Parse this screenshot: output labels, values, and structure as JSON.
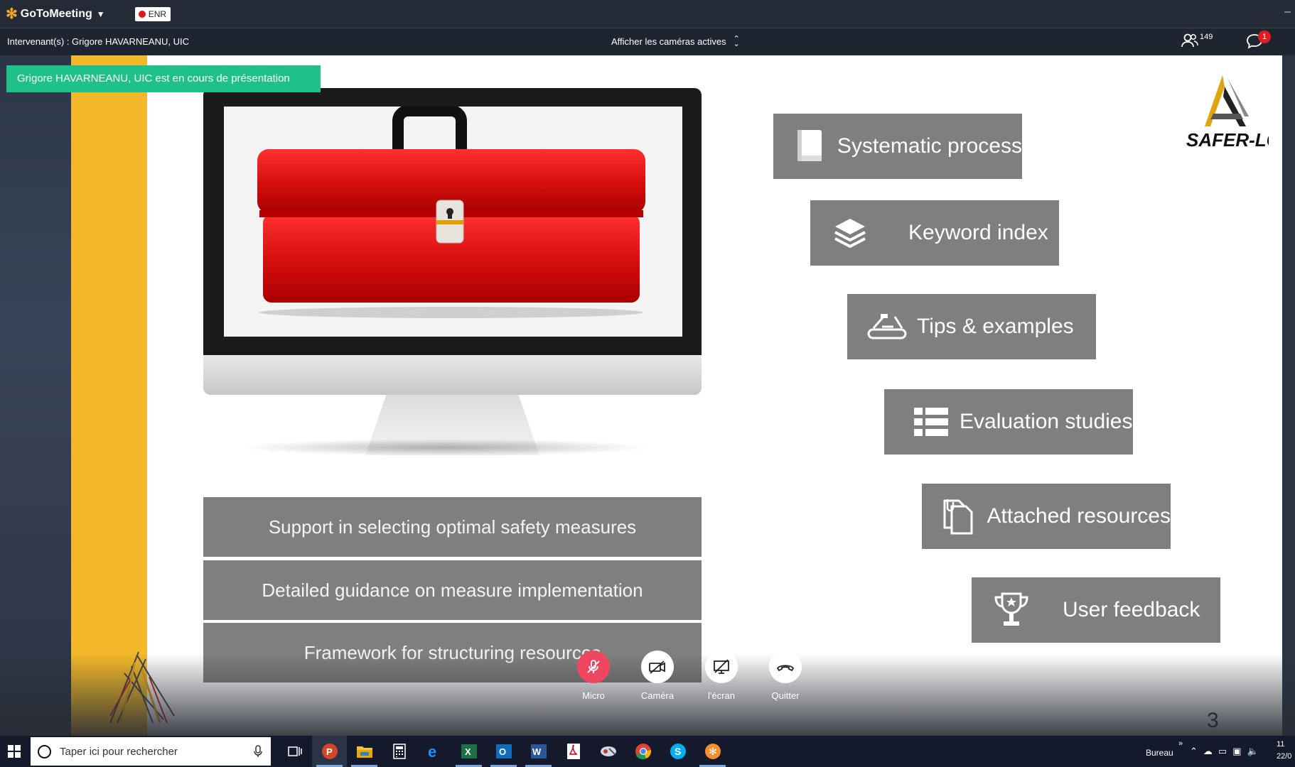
{
  "app": {
    "brand": "GoToMeeting",
    "recording_label": "ENR"
  },
  "session": {
    "speakers": "Intervenant(s) : Grigore HAVARNEANU, UIC",
    "camera_selector": "Afficher les caméras actives",
    "attendee_count": "149",
    "chat_badge": "1"
  },
  "banner": {
    "presenting": "Grigore HAVARNEANU, UIC est en cours de présentation"
  },
  "slide": {
    "left_items": [
      "Support in selecting optimal safety measures",
      "Detailed guidance on measure implementation",
      "Framework for structuring resources"
    ],
    "features": [
      {
        "label": "Systematic process",
        "icon": "book-icon"
      },
      {
        "label": "Keyword index",
        "icon": "layers-icon"
      },
      {
        "label": "Tips & examples",
        "icon": "tools-icon"
      },
      {
        "label": "Evaluation studies",
        "icon": "list-icon"
      },
      {
        "label": "Attached resources",
        "icon": "documents-icon"
      },
      {
        "label": "User feedback",
        "icon": "trophy-icon"
      }
    ],
    "logo_text": "SAFER-LC",
    "page_number": "3"
  },
  "controls": {
    "mic": "Micro",
    "camera": "Caméra",
    "screen": "l'écran",
    "quit": "Quitter"
  },
  "taskbar": {
    "search_placeholder": "Taper ici pour rechercher",
    "desktop_label": "Bureau",
    "clock_time": "11",
    "clock_date": "22/0"
  },
  "colors": {
    "presenting_banner": "#1fc18a",
    "feature_box": "#7f7f7f",
    "slide_accent": "#f2b829",
    "mic_muted": "#f04760"
  }
}
